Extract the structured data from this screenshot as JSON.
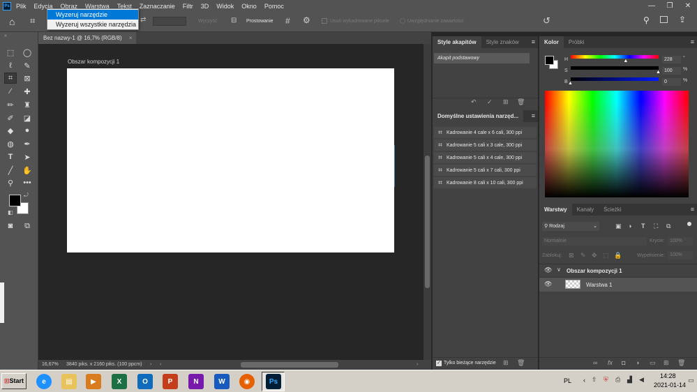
{
  "menu": {
    "items": [
      "Plik",
      "Edycja",
      "Obraz",
      "Warstwa",
      "Tekst",
      "Zaznaczanie",
      "Filtr",
      "3D",
      "Widok",
      "Okno",
      "Pomoc"
    ]
  },
  "dropdown": {
    "items": [
      "Wyzeruj narzędzie",
      "Wyzeruj wszystkie narzędzia"
    ]
  },
  "options": {
    "clear": "Wyczyść",
    "straighten": "Prostowanie",
    "delete_cropped": "Usuń wykadrowane piksele",
    "content_aware": "Uwzględnianie zawartości"
  },
  "doc": {
    "tab_title": "Bez nazwy-1 @ 16,7% (RGB/8)",
    "artboard_label": "Obszar kompozycji 1"
  },
  "status": {
    "zoom": "16,67%",
    "info": "3840 piks. x 2160 piks. (100 ppcm)"
  },
  "char_styles": {
    "tabs": [
      "Style akapitów",
      "Style znaków"
    ],
    "item": "Akapit podstawowy"
  },
  "tool_presets": {
    "title": "Domyślne ustawienia narzęd...",
    "items": [
      "Kadrowanie 4 cale x 6 cali, 300 ppi",
      "Kadrowanie 5 cali x 3 cale, 300 ppi",
      "Kadrowanie 5 cali x 4 cale, 300 ppi",
      "Kadrowanie 5 cali x 7 cali, 300 ppi",
      "Kadrowanie 8 cali x 10 cali, 300 ppi"
    ],
    "current_only": "Tylko bieżące narzędzie"
  },
  "color": {
    "tabs": [
      "Kolor",
      "Próbki"
    ],
    "h_label": "H",
    "s_label": "S",
    "b_label": "B",
    "h": "228",
    "s": "100",
    "b": "0",
    "pct": "%",
    "deg": "°",
    "h_level": 0.63,
    "s_level": 1.0,
    "b_level": 0.0
  },
  "layers": {
    "tabs": [
      "Warstwy",
      "Kanały",
      "Ścieżki"
    ],
    "filter": "Rodzaj",
    "mode": "Normalnie",
    "opacity_label": "Krycie:",
    "opacity": "100%",
    "lock_label": "Zablokuj:",
    "fill_label": "Wypełnienie:",
    "fill": "100%",
    "group": "Obszar kompozycji 1",
    "layer": "Warstwa 1"
  },
  "taskbar": {
    "start": "Start",
    "lang": "PL",
    "time": "14:28",
    "date": "2021-01-14"
  },
  "colors": {
    "accent": "#31a8ff",
    "select": "#0078d7"
  }
}
